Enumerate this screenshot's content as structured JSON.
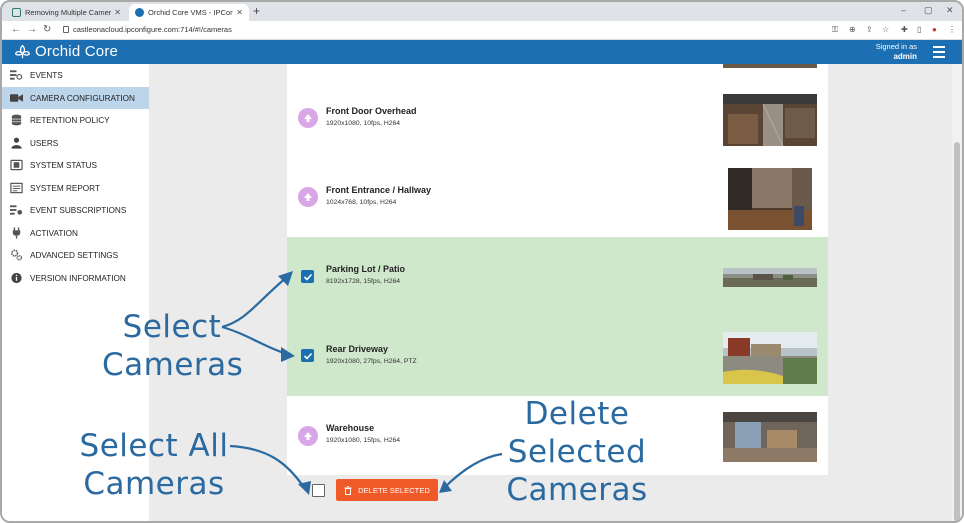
{
  "browser": {
    "tabs": [
      {
        "title": "Removing Multiple Cameras - Or",
        "active": false
      },
      {
        "title": "Orchid Core VMS - IPConfigure",
        "active": true
      }
    ],
    "url": "castleonacloud.ipconfigure.com:714/#!/cameras"
  },
  "header": {
    "app_name": "Orchid Core",
    "signed_in_label": "Signed in as",
    "username": "admin"
  },
  "sidebar": {
    "items": [
      {
        "label": "EVENTS",
        "icon": "events-icon"
      },
      {
        "label": "CAMERA CONFIGURATION",
        "icon": "camera-icon",
        "active": true
      },
      {
        "label": "RETENTION POLICY",
        "icon": "database-icon"
      },
      {
        "label": "USERS",
        "icon": "user-icon"
      },
      {
        "label": "SYSTEM STATUS",
        "icon": "status-icon"
      },
      {
        "label": "SYSTEM REPORT",
        "icon": "report-icon"
      },
      {
        "label": "EVENT SUBSCRIPTIONS",
        "icon": "subscriptions-icon"
      },
      {
        "label": "ACTIVATION",
        "icon": "plug-icon"
      },
      {
        "label": "ADVANCED SETTINGS",
        "icon": "gears-icon"
      },
      {
        "label": "VERSION INFORMATION",
        "icon": "info-icon"
      }
    ]
  },
  "cameras": [
    {
      "name": "Front Door Overhead",
      "info": "1920x1080, 10fps, H264",
      "selected": false
    },
    {
      "name": "Front Entrance / Hallway",
      "info": "1024x768, 10fps, H264",
      "selected": false
    },
    {
      "name": "Parking Lot / Patio",
      "info": "8192x1728, 15fps, H264",
      "selected": true
    },
    {
      "name": "Rear Driveway",
      "info": "1920x1080, 27fps, H264, PTZ",
      "selected": true
    },
    {
      "name": "Warehouse",
      "info": "1920x1080, 15fps, H264",
      "selected": false
    }
  ],
  "actions": {
    "delete_selected_label": "DELETE SELECTED"
  },
  "callouts": {
    "select_cameras": [
      "Select",
      "Cameras"
    ],
    "select_all": [
      "Select All",
      "Cameras"
    ],
    "delete_selected": [
      "Delete",
      "Selected",
      "Cameras"
    ]
  },
  "colors": {
    "brand_blue": "#1c6fb2",
    "selected_row": "#cfe8cb",
    "delete_button": "#f05a28",
    "upload_icon": "#d9a7e8",
    "callout": "#2a6aa0"
  }
}
